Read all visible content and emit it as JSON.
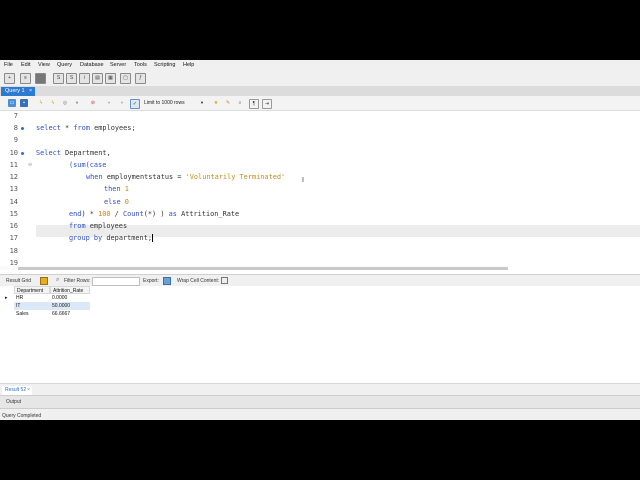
{
  "menu": [
    "File",
    "Edit",
    "View",
    "Query",
    "Database",
    "Server",
    "Tools",
    "Scripting",
    "Help"
  ],
  "tab": {
    "label": "Query 1",
    "close": "×"
  },
  "editor_toolbar": {
    "limit_label": "Limit to 1000 rows"
  },
  "editor": {
    "line_numbers": [
      "7",
      "8",
      "9",
      "10",
      "11",
      "12",
      "13",
      "14",
      "15",
      "16",
      "17",
      "18",
      "19"
    ],
    "lines": {
      "l8": {
        "kw1": "select",
        "star": " * ",
        "kw2": "from",
        "rest": " employees;"
      },
      "l10": {
        "kw1": "Select",
        "rest": " Department,"
      },
      "l11": {
        "fn": "(sum(",
        "kw": "case"
      },
      "l12": {
        "kw": "when",
        "mid": " employmentstatus = ",
        "str": "'Voluntarily Terminated'"
      },
      "l13": {
        "kw": "then",
        "num": " 1"
      },
      "l14": {
        "kw": "else",
        "num": " 0"
      },
      "l15": {
        "kw1": "end",
        "p1": ") * ",
        "num": "100",
        "p2": " / ",
        "fn": "Count",
        "p3": "(*) ) ",
        "kw2": "as",
        "rest": " Attrition_Rate"
      },
      "l16": {
        "kw": "from",
        "rest": " employees"
      },
      "l17": {
        "kw1": "group",
        "sp": " ",
        "kw2": "by",
        "rest": " department;"
      }
    }
  },
  "results_toolbar": {
    "result_grid": "Result Grid",
    "filter_rows": "Filter Rows:",
    "export": "Export:",
    "wrap": "Wrap Cell Content:"
  },
  "results": {
    "columns": [
      "Department",
      "Attrition_Rate"
    ],
    "rows": [
      [
        "HR",
        "0.0000"
      ],
      [
        "IT",
        "50.0000"
      ],
      [
        "Sales",
        "66.6667"
      ]
    ]
  },
  "result_tab": {
    "label": "Result 52",
    "close": "×"
  },
  "output_label": "Output",
  "status_text": "Query Completed",
  "colors": {
    "accent": "#2d7ad1",
    "keyword": "#2f4fc9",
    "string": "#c88a19",
    "number": "#d87b1a"
  }
}
